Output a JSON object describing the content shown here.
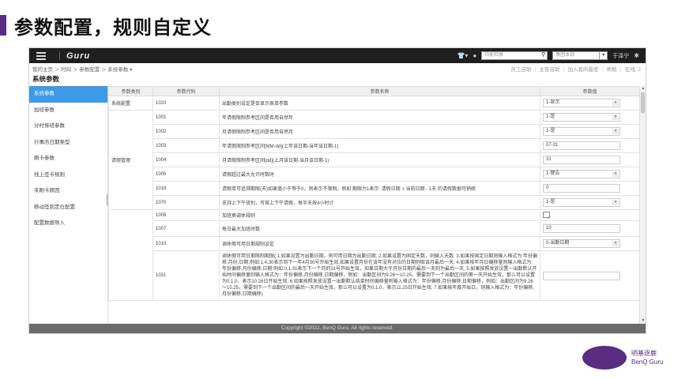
{
  "slide": {
    "title": "参数配置，规则自定义"
  },
  "topbar": {
    "brand": "Guru",
    "search_placeholder": "功能检索",
    "dept_placeholder": "集团本部",
    "user": "于泽宁",
    "icons": [
      "menu-icon",
      "shirt-icon",
      "chat-icon",
      "search-icon",
      "gear-icon"
    ]
  },
  "breadcrumb": "我的主页 ＞ 时间 ＞ 参数配置 ＞ 系统参数 ▾",
  "header_links": "员工自助 ｜ 主管自助 ｜ 加入我的最爱 ｜ 帮助 ｜ 在线: 2",
  "page_title": "系统参数",
  "sidebar": {
    "items": [
      "系统参数",
      "加班参数",
      "分时排班参数",
      "行事历日期类型",
      "刷卡参数",
      "线上签卡规则",
      "未刷卡原因",
      "移动签到定位配置",
      "配置数据导入"
    ]
  },
  "table": {
    "headers": [
      "参数类别",
      "参数代码",
      "参数名称",
      "参数值"
    ],
    "rows": [
      {
        "category": "系统配置",
        "code": "1020",
        "name": "出勤类别设定是否显示表单参数",
        "value": "1-显示",
        "kind": "select"
      },
      {
        "category": "",
        "code": "1001",
        "name": "年请假限制参考区间是否用自然年",
        "value": "1-是",
        "kind": "select"
      },
      {
        "category": "",
        "code": "1002",
        "name": "月请假限制参考区间是否用自然月",
        "value": "1-是",
        "kind": "select"
      },
      {
        "category": "",
        "code": "1003",
        "name": "年请假限制参考区间[MM-dd](上年该日期-当年该日期-1)",
        "value": "07-31",
        "kind": "input"
      },
      {
        "category": "请假管理",
        "code": "1004",
        "name": "月请假限制参考区间[dd](上月该日期-当月该日期-1)",
        "value": "31",
        "kind": "input"
      },
      {
        "category": "",
        "code": "1005",
        "name": "请假超过最大允许时数时",
        "value": "1-警告",
        "kind": "select"
      },
      {
        "category": "",
        "code": "1018",
        "name": "请假单可追溯期限(天)如果值小于等于0，则表示不限制。例如:期限为1表示: 请假日期 > 当前日期 - 1天 的请假数据可销假",
        "value": "0",
        "kind": "input"
      },
      {
        "category": "",
        "code": "1070",
        "name": "支持上下午班别，可按上下午请假，每半天按4小时计",
        "value": "1-是",
        "kind": "select"
      },
      {
        "category": "",
        "code": "1008",
        "name": "加班换调休规则",
        "value": "",
        "kind": "edit"
      },
      {
        "category": "",
        "code": "1007",
        "name": "每日最大加班时数",
        "value": "10",
        "kind": "input"
      },
      {
        "category": "",
        "code": "1010",
        "name": "调休假可用日期规则设定",
        "value": "0-出勤日期",
        "kind": "select"
      },
      {
        "category": "",
        "code": "1031",
        "name": "调休假可用日期限制期限( 1.如果设置为出勤日期，则可用日期为出勤日期; 2.如果设置为固定天数，则输入天数; 3.如果按固定日期则输入格式为:年份偏移,月份,日期;例如:1,4,30表示到下一年4月30号开始生效,如果设置月份在该年没有对应的日期则取该月最后一天; 4.如果按年月日偏移量则输入格式为:年份偏移,月份偏移,日期;例如:0,1,31表示下一个月的31号开始生效，如果日期大于月份日期的最后一天则为最后一天; 5.如果按照发放设置一出勤默认开始时间偏移量则输入格式为：年份偏移,月份偏移,日期偏移，例如：出勤区间为9.26～10.25，需要到下一个出勤区间的第一天开始生效，那么可以设置为0,1,0，表示10.26日开始生效; 6.如果按照发放设置一出勤默认结束时间偏移量则输入格式为：年份偏移,月份偏移,日期偏移，例如：出勤区间为9.26～10.25，需要到下一个出勤区间的最后一天开始生效，那么可以设置为0,1,0，表示11.25日开始生效; 7.如果按年度开始日，则输入格式为：年份偏移,月份偏移,日期偏移)",
        "value": "",
        "kind": "none"
      }
    ]
  },
  "footer": "Copyright ©2022, BenQ Guru. All rights reserved.",
  "logo": {
    "mark": "BenQ",
    "line1": "明基逐鹿",
    "line2": "BenQ Guru"
  }
}
